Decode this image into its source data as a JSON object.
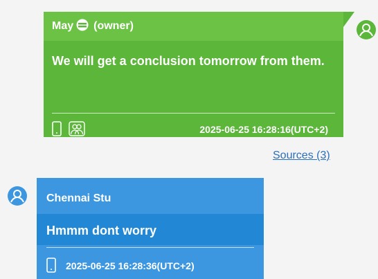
{
  "messages": [
    {
      "sender": "May",
      "role": "(owner)",
      "text": "We will get a conclusion tomorrow from them.",
      "timestamp": "2025-06-25 16:28:16(UTC+2)",
      "icons": [
        "phone-icon",
        "group-icon",
        "emoji-icon",
        "avatar-icon"
      ],
      "color": "#5bb63a"
    },
    {
      "sender": "Chennai Stu",
      "text": "Hmmm dont worry",
      "timestamp": "2025-06-25 16:28:36(UTC+2)",
      "icons": [
        "phone-icon",
        "avatar-icon"
      ],
      "color": "#3c97e0"
    }
  ],
  "sources_label": "Sources (3)"
}
